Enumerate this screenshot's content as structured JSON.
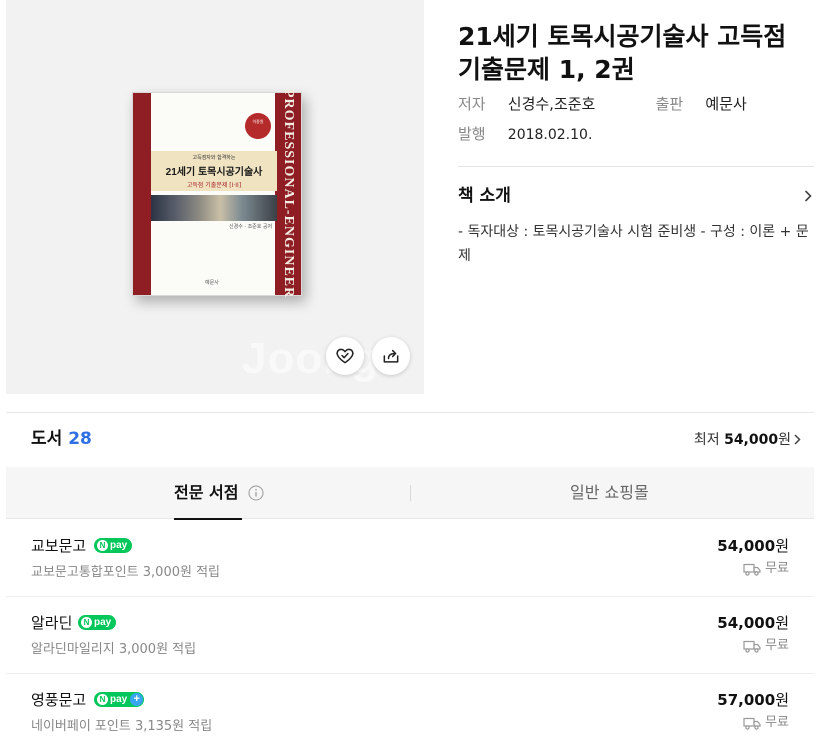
{
  "product": {
    "title": "21세기 토목시공기술사 고득점 기출문제 1, 2권",
    "author_label": "저자",
    "author": "신경수,조준호",
    "publisher_label": "출판",
    "publisher": "예문사",
    "date_label": "발행",
    "date": "2018.02.10."
  },
  "cover": {
    "watermark": "Joongo",
    "spine_text": "PROFESSIONAL-ENGINEER",
    "badge_text": "이종원",
    "band_subtitle": "고득점자와 합격하는",
    "band_title": "21세기 토목시공기술사",
    "band_subtitle2": "고득점 기출문제 [I·II]",
    "authors_small": "신경수 · 조준호 공저",
    "publisher_small": "예문사"
  },
  "intro": {
    "title": "책 소개",
    "text": "- 독자대상 : 토목시공기술사 시험 준비생 - 구성 : 이론 + 문제"
  },
  "listing": {
    "label": "도서",
    "count": "28",
    "lowest_prefix": "최저",
    "lowest_price": "54,000",
    "lowest_suffix": "원"
  },
  "tabs": {
    "pro": "전문 서점",
    "general": "일반 쇼핑몰"
  },
  "sellers": [
    {
      "name": "교보문고",
      "pay": "pay",
      "pay_plus": false,
      "point": "교보문고통합포인트 3,000원 적립",
      "price": "54,000",
      "won": "원",
      "shipping": "무료"
    },
    {
      "name": "알라딘",
      "pay": "pay",
      "pay_plus": false,
      "point": "알라딘마일리지 3,000원 적립",
      "price": "54,000",
      "won": "원",
      "shipping": "무료"
    },
    {
      "name": "영풍문고",
      "pay": "pay",
      "pay_plus": true,
      "point": "네이버페이 포인트 3,135원 적립",
      "price": "57,000",
      "won": "원",
      "shipping": "무료"
    }
  ],
  "colors": {
    "accent_blue": "#2f6fe4",
    "npay_green": "#03c75a",
    "npay_plus_blue": "#38a5f1",
    "cover_red": "#8e1d24"
  }
}
